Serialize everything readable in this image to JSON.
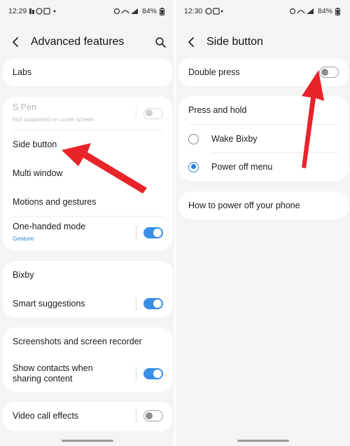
{
  "left_screen": {
    "status": {
      "time": "12:29",
      "battery": "84%"
    },
    "header": {
      "title": "Advanced features"
    },
    "card1": {
      "labs": "Labs"
    },
    "card2": {
      "s_pen": "S Pen",
      "s_pen_sub": "Not supported on cover screen",
      "side_button": "Side button",
      "multi_window": "Multi window",
      "motions": "Motions and gestures",
      "one_handed": "One-handed mode",
      "one_handed_sub": "Gesture"
    },
    "card3": {
      "bixby": "Bixby",
      "smart_suggestions": "Smart suggestions"
    },
    "card4": {
      "screenshots": "Screenshots and screen recorder",
      "show_contacts": "Show contacts when sharing content"
    },
    "card5": {
      "video_call": "Video call effects"
    },
    "toggles": {
      "s_pen": false,
      "one_handed": true,
      "smart_suggestions": true,
      "show_contacts": true,
      "video_call": false
    }
  },
  "right_screen": {
    "status": {
      "time": "12:30",
      "battery": "84%"
    },
    "header": {
      "title": "Side button"
    },
    "double_press": {
      "label": "Double press",
      "enabled": false
    },
    "press_hold": {
      "label": "Press and hold",
      "options": [
        "Wake Bixby",
        "Power off menu"
      ],
      "selected": "Power off menu"
    },
    "how_to": "How to power off your phone"
  },
  "colors": {
    "accent": "#3a8ee6",
    "arrow": "#e8242a",
    "background": "#f4f4f4"
  }
}
